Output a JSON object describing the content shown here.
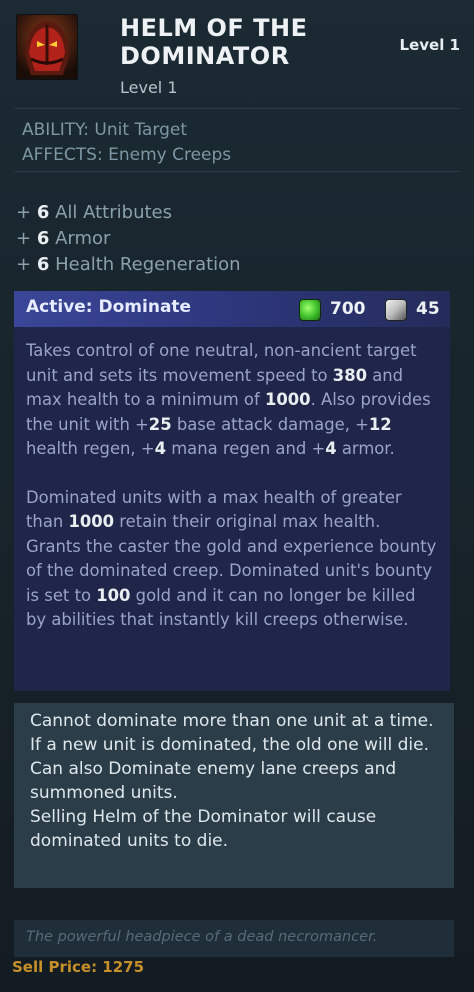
{
  "item": {
    "name_line1": "HELM OF THE",
    "name_line2": "DOMINATOR",
    "level_label": "Level 1",
    "level_right": "Level 1",
    "icon": "helm-icon"
  },
  "ability": {
    "target": "ABILITY: Unit Target",
    "affects": "AFFECTS: Enemy Creeps"
  },
  "attributes": [
    {
      "plus": "+",
      "value": "6",
      "label": "All Attributes"
    },
    {
      "plus": "+",
      "value": "6",
      "label": "Armor"
    },
    {
      "plus": "+",
      "value": "6",
      "label": "Health Regeneration"
    }
  ],
  "active": {
    "title": "Active: Dominate",
    "mana_cost": "700",
    "cooldown": "45",
    "para1": {
      "t1": "Takes control of one neutral, non-ancient target unit and sets its movement speed to ",
      "v1": "380",
      "t2": " and max health to a minimum of ",
      "v2": "1000",
      "t3": ". Also provides the unit with +",
      "v3": "25",
      "t4": " base attack damage, +",
      "v4": "12",
      "t5": " health regen, +",
      "v5": "4",
      "t6": " mana regen and +",
      "v6": "4",
      "t7": " armor."
    },
    "para2": {
      "t1": "Dominated units with a max health of greater than ",
      "v1": "1000",
      "t2": " retain their original max health. Grants the caster the gold and experience bounty of the dominated creep. Dominated unit's bounty is set to ",
      "v2": "100",
      "t3": " gold and it can no longer be killed by abilities that instantly kill creeps otherwise."
    }
  },
  "notes": [
    "Cannot dominate more than one unit at a time. If a new unit is dominated, the old one will die.",
    "Can also Dominate enemy lane creeps and summoned units.",
    "Selling Helm of the Dominator will cause dominated units to die."
  ],
  "lore": "The powerful headpiece of a dead necromancer.",
  "sell_price": "Sell Price: 1275",
  "colors": {
    "background": "#172229",
    "active_header": "#3b4698",
    "active_body": "#20254a",
    "notes_bg": "#2b3d49",
    "sell_gold": "#c8902a",
    "mana_green": "#3fbf2b"
  }
}
